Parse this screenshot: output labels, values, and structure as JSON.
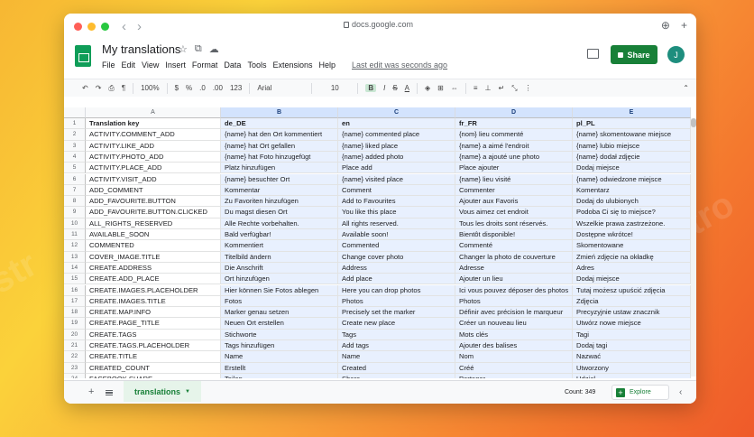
{
  "browser": {
    "url": "docs.google.com"
  },
  "doc": {
    "title": "My translations",
    "menu": [
      "File",
      "Edit",
      "View",
      "Insert",
      "Format",
      "Data",
      "Tools",
      "Extensions",
      "Help"
    ],
    "last_edit": "Last edit was seconds ago",
    "share_label": "Share",
    "avatar_initial": "J"
  },
  "toolbar": {
    "zoom": "100%",
    "currency": "$",
    "percent": "%",
    "dec_decrease": ".0",
    "dec_increase": ".00",
    "format_123": "123",
    "font": "Arial",
    "font_size": "10",
    "bold": "B",
    "italic": "I",
    "strike": "S",
    "text_color": "A"
  },
  "grid": {
    "columns": [
      "A",
      "B",
      "C",
      "D",
      "E"
    ],
    "rows": [
      [
        "1",
        "Translation key",
        "de_DE",
        "en",
        "fr_FR",
        "pl_PL"
      ],
      [
        "2",
        "ACTIVITY.COMMENT_ADD",
        "{name} hat den Ort kommentiert",
        "{name} commented place",
        "{nom} lieu commenté",
        "{name} skomentowane miejsce"
      ],
      [
        "3",
        "ACTIVITY.LIKE_ADD",
        "{name} hat Ort gefallen",
        "{name} liked place",
        "{name} a aimé l'endroit",
        "{name} lubio miejsce"
      ],
      [
        "4",
        "ACTIVITY.PHOTO_ADD",
        "{name} hat Foto hinzugefügt",
        "{name} added photo",
        "{name} a ajouté une photo",
        "{name} dodał zdjęcie"
      ],
      [
        "5",
        "ACTIVITY.PLACE_ADD",
        "Platz hinzufügen",
        "Place add",
        "Place ajouter",
        "Dodaj miejsce"
      ],
      [
        "6",
        "ACTIVITY.VISIT_ADD",
        "{name} besuchter Ort",
        "{name} visited place",
        "{name} lieu visité",
        "{name} odwiedzone miejsce"
      ],
      [
        "7",
        "ADD_COMMENT",
        "Kommentar",
        "Comment",
        "Commenter",
        "Komentarz"
      ],
      [
        "8",
        "ADD_FAVOURITE.BUTTON",
        "Zu Favoriten hinzufügen",
        "Add to Favourites",
        "Ajouter aux Favoris",
        "Dodaj do ulubionych"
      ],
      [
        "9",
        "ADD_FAVOURITE.BUTTON.CLICKED",
        "Du magst diesen Ort",
        "You like this place",
        "Vous aimez cet endroit",
        "Podoba Ci się to miejsce?"
      ],
      [
        "10",
        "ALL_RIGHTS_RESERVED",
        "Alle Rechte vorbehalten.",
        "All rights reserved.",
        "Tous les droits sont réservés.",
        "Wszelkie prawa zastrzeżone."
      ],
      [
        "11",
        "AVAILABLE_SOON",
        "Bald verfügbar!",
        "Available soon!",
        "Bientôt disponible!",
        "Dostępne wkrótce!"
      ],
      [
        "12",
        "COMMENTED",
        "Kommentiert",
        "Commented",
        "Commenté",
        "Skomentowane"
      ],
      [
        "13",
        "COVER_IMAGE.TITLE",
        "Titelbild ändern",
        "Change cover photo",
        "Changer la photo de couverture",
        "Zmień zdjęcie na okładkę"
      ],
      [
        "14",
        "CREATE.ADDRESS",
        "Die Anschrift",
        "Address",
        "Adresse",
        "Adres"
      ],
      [
        "15",
        "CREATE.ADD_PLACE",
        "Ort hinzufügen",
        "Add place",
        "Ajouter un lieu",
        "Dodaj miejsce"
      ],
      [
        "16",
        "CREATE.IMAGES.PLACEHOLDER",
        "Hier können Sie Fotos ablegen",
        "Here you can drop photos",
        "Ici vous pouvez déposer des photos",
        "Tutaj możesz upuścić zdjęcia"
      ],
      [
        "17",
        "CREATE.IMAGES.TITLE",
        "Fotos",
        "Photos",
        "Photos",
        "Zdjęcia"
      ],
      [
        "18",
        "CREATE.MAP.INFO",
        "Marker genau setzen",
        "Precisely set the marker",
        "Définir avec précision le marqueur",
        "Precyzyjnie ustaw znacznik"
      ],
      [
        "19",
        "CREATE.PAGE_TITLE",
        "Neuen Ort erstellen",
        "Create new place",
        "Créer un nouveau lieu",
        "Utwórz nowe miejsce"
      ],
      [
        "20",
        "CREATE.TAGS",
        "Stichworte",
        "Tags",
        "Mots clés",
        "Tagi"
      ],
      [
        "21",
        "CREATE.TAGS.PLACEHOLDER",
        "Tags hinzufügen",
        "Add tags",
        "Ajouter des balises",
        "Dodaj tagi"
      ],
      [
        "22",
        "CREATE.TITLE",
        "Name",
        "Name",
        "Nom",
        "Nazwać"
      ],
      [
        "23",
        "CREATED_COUNT",
        "Erstellt",
        "Created",
        "Créé",
        "Utworzony"
      ],
      [
        "24",
        "FACEBOOK.SHARE",
        "Teilen",
        "Share",
        "Partager",
        "Udział"
      ]
    ]
  },
  "bottom": {
    "sheet_name": "translations",
    "count_label": "Count: 349",
    "explore_label": "Explore"
  },
  "colors": {
    "accent_green": "#188038",
    "selection_blue": "#e8f0fe"
  }
}
